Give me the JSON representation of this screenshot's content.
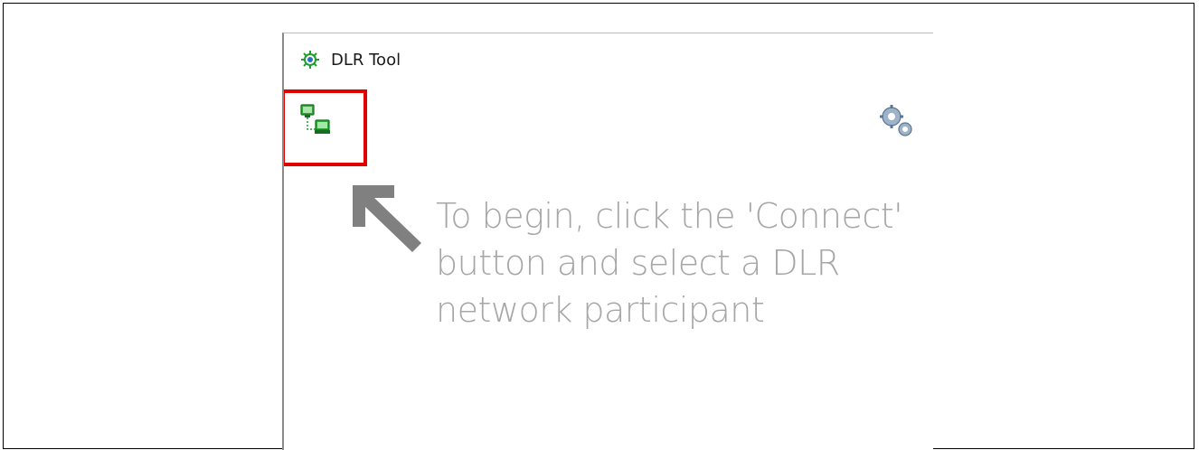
{
  "window": {
    "title": "DLR Tool"
  },
  "toolbar": {
    "connect_icon": "connect-network-icon",
    "settings_icon": "gears-icon"
  },
  "hint": {
    "lines": [
      "To begin, click the 'Connect'",
      "button and select a DLR",
      "network participant"
    ]
  },
  "colors": {
    "highlight": "#e00000",
    "hint_text": "#a6a6a6",
    "icon_green": "#1f9e2c"
  }
}
